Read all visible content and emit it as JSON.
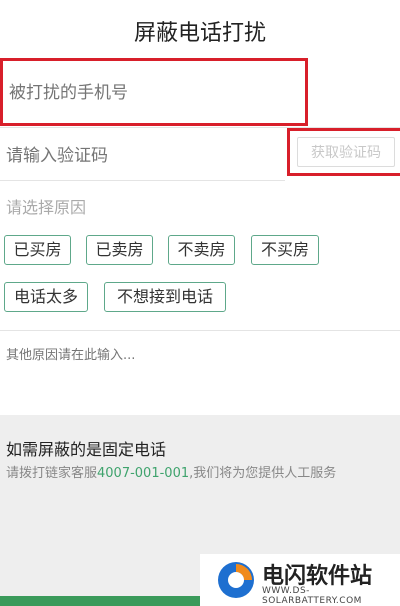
{
  "header": {
    "title": "屏蔽电话打扰"
  },
  "form": {
    "phone_placeholder": "被打扰的手机号",
    "code_placeholder": "请输入验证码",
    "code_button": "获取验证码",
    "reason_label": "请选择原因",
    "reasons": [
      "已买房",
      "已卖房",
      "不卖房",
      "不买房",
      "电话太多",
      "不想接到电话"
    ],
    "other_placeholder": "其他原因请在此输入..."
  },
  "fixed_line": {
    "title": "如需屏蔽的是固定电话",
    "hint_prefix": "请拨打链家客服",
    "hotline": "4007-001-001",
    "hint_suffix": ",我们将为您提供人工服务"
  },
  "watermark": {
    "title": "电闪软件站",
    "subtitle": "WWW.DS-SOLARBATTERY.COM"
  },
  "colors": {
    "accent_green": "#3fa36d",
    "highlight_red": "#d81f2a",
    "tag_border": "#5ea88a"
  }
}
